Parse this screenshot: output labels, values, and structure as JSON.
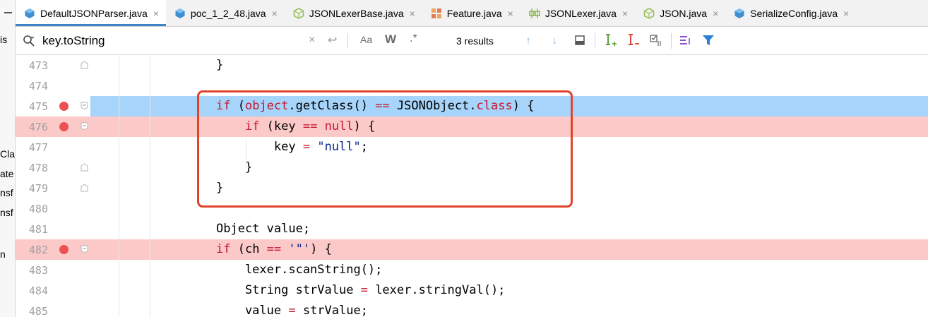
{
  "left_panel": {
    "fragments": [
      "is",
      "Cla",
      "ate",
      "nsf",
      "nsf",
      "n"
    ]
  },
  "tabs": [
    {
      "label": "DefaultJSONParser.java",
      "icon": "java-class-icon",
      "icon_color": "#3e8ed0",
      "active": true
    },
    {
      "label": "poc_1_2_48.java",
      "icon": "java-class-icon",
      "icon_color": "#3e8ed0",
      "active": false
    },
    {
      "label": "JSONLexerBase.java",
      "icon": "abstract-class-icon",
      "icon_color": "#9bbf5a",
      "active": false
    },
    {
      "label": "Feature.java",
      "icon": "enum-icon",
      "icon_color": "#e37b52",
      "active": false
    },
    {
      "label": "JSONLexer.java",
      "icon": "interface-icon",
      "icon_color": "#7fb23d",
      "active": false
    },
    {
      "label": "JSON.java",
      "icon": "abstract-class-icon",
      "icon_color": "#9bbf5a",
      "active": false
    },
    {
      "label": "SerializeConfig.java",
      "icon": "java-class-icon",
      "icon_color": "#3e8ed0",
      "active": false
    }
  ],
  "tab_close_glyph": "×",
  "search": {
    "value": "key.toString",
    "clear_glyph": "×",
    "enter_glyph": "↩",
    "match_case_label": "Aa",
    "words_label": "W",
    "regex_label": ".*",
    "results_text": "3 results",
    "prev_glyph": "↑",
    "next_glyph": "↓"
  },
  "editor": {
    "lines": [
      {
        "n": "473",
        "code": [
          [
            "",
            "}"
          ]
        ],
        "hl": "",
        "bp": false,
        "fold": "end"
      },
      {
        "n": "474",
        "code": [],
        "hl": "",
        "bp": false,
        "fold": ""
      },
      {
        "n": "475",
        "code": [
          [
            "kw",
            "if"
          ],
          [
            "",
            " ("
          ],
          [
            "kw",
            "object"
          ],
          [
            "",
            ".getClass() "
          ],
          [
            "kw",
            "=="
          ],
          [
            "",
            " JSONObject."
          ],
          [
            "kw",
            "class"
          ],
          [
            "",
            ") {"
          ]
        ],
        "hl": "blue",
        "bp": true,
        "fold": "start"
      },
      {
        "n": "476",
        "code": [
          [
            "",
            "    "
          ],
          [
            "kw",
            "if"
          ],
          [
            "",
            " (key "
          ],
          [
            "kw",
            "=="
          ],
          [
            "",
            " "
          ],
          [
            "kw",
            "null"
          ],
          [
            "",
            ") {"
          ]
        ],
        "hl": "red",
        "bp": true,
        "fold": "start"
      },
      {
        "n": "477",
        "code": [
          [
            "",
            "        key "
          ],
          [
            "kw",
            "="
          ],
          [
            "",
            " "
          ],
          [
            "str",
            "\"null\""
          ],
          [
            "",
            ";"
          ]
        ],
        "hl": "",
        "bp": false,
        "fold": ""
      },
      {
        "n": "478",
        "code": [
          [
            "",
            "    }"
          ]
        ],
        "hl": "",
        "bp": false,
        "fold": "end"
      },
      {
        "n": "479",
        "code": [
          [
            "",
            "}"
          ]
        ],
        "hl": "",
        "bp": false,
        "fold": "end"
      },
      {
        "n": "480",
        "code": [],
        "hl": "",
        "bp": false,
        "fold": ""
      },
      {
        "n": "481",
        "code": [
          [
            "",
            "Object value;"
          ]
        ],
        "hl": "",
        "bp": false,
        "fold": ""
      },
      {
        "n": "482",
        "code": [
          [
            "kw",
            "if"
          ],
          [
            "",
            " (ch "
          ],
          [
            "kw",
            "=="
          ],
          [
            "",
            " "
          ],
          [
            "str",
            "'\"'"
          ],
          [
            "",
            ") {"
          ]
        ],
        "hl": "red",
        "bp": true,
        "fold": "start"
      },
      {
        "n": "483",
        "code": [
          [
            "",
            "    lexer.scanString();"
          ]
        ],
        "hl": "",
        "bp": false,
        "fold": ""
      },
      {
        "n": "484",
        "code": [
          [
            "",
            "    String strValue "
          ],
          [
            "kw",
            "="
          ],
          [
            "",
            " lexer.stringVal();"
          ]
        ],
        "hl": "",
        "bp": false,
        "fold": ""
      },
      {
        "n": "485",
        "code": [
          [
            "",
            "    value "
          ],
          [
            "kw",
            "="
          ],
          [
            "",
            " strValue;"
          ]
        ],
        "hl": "",
        "bp": false,
        "fold": ""
      }
    ]
  },
  "colors": {
    "tab_active_underline": "#4083c9",
    "execution_line": "#a7d4fa",
    "breakpoint_line": "#fcc9c9",
    "breakpoint_dot": "#ec5152",
    "annotation_box": "#e2432b",
    "keyword": "#c5172e",
    "string": "#0b2a88"
  }
}
